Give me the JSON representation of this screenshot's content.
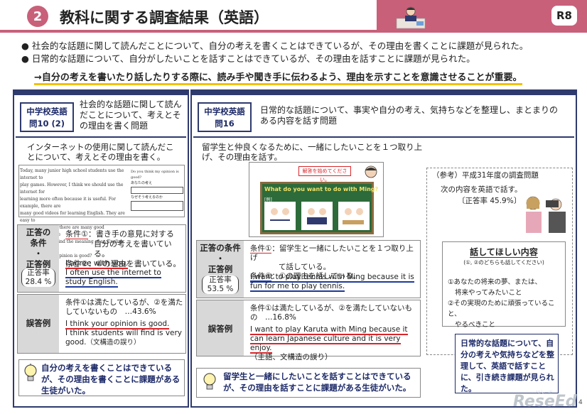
{
  "header": {
    "number": "2",
    "title": "教科に関する調査結果（英語）",
    "badge": "R8"
  },
  "bullets": [
    "●  社会的な話題に関して読んだことについて、自分の考えを書くことはできているが、その理由を書くことに課題が見られた。",
    "●  日常的な話題について、自分がしたいことを話すことはできているが、その理由を話すことに課題が見られた。"
  ],
  "key_point": "→自分の考えを書いたり話したりする際に、読み手や聞き手に伝わるよう、理由を示すことを意識させることが重要。",
  "left": {
    "q_label_1": "中学校英語",
    "q_label_2": "問10 (2)",
    "q_desc": "社会的な話題に関して読んだことについて、考えとその理由を書く問題",
    "prompt": "インターネットの使用に関して読んだことについて、考えとその理由を書く。",
    "quote_lines": [
      "Today, many junior high school students use the internet to",
      "play games. However, I think we should use the internet for",
      "learning more often because it is useful. For example, there are",
      "many good videos for learning English. They are easy to",
      "understand. Also, there are many good dictionaries on the",
      "internet. We can find the meaning of an English word quickly.",
      "Do you think my opinion is good?"
    ],
    "form_q": "Do you think my opinion is good?",
    "form_label_1": "あなたの考え",
    "form_label_2": "なぜそう考えるのか",
    "correct_label_1": "正答の",
    "correct_label_2": "条件",
    "correct_dot": "・",
    "correct_label_3": "正答例",
    "rate_label": "正答率",
    "rate_value": "28.4 %",
    "cond1": "条件①：書き手の意見に対する",
    "cond1b": "自分の考えを書いている。",
    "cond2": "条件②：①の理由を書いている。",
    "example1": "I agree with you.",
    "example2": "I often use the internet to study English.",
    "wrong_label": "誤答例",
    "wrong_desc1": "条件①は満たしているが、②を満た",
    "wrong_desc2": "していないもの　…43.6%",
    "wrong_ex1": "I think your opinion is good.",
    "wrong_ex2": "I think students will find is very good.",
    "wrong_note": "（文構造の誤り）",
    "tip": "自分の考えを書くことはできているが、その理由を書くことに課題がある生徒がいた。"
  },
  "right": {
    "q_label_1": "中学校英語",
    "q_label_2": "問16",
    "q_desc": "日常的な話題について、事実や自分の考え、気持ちなどを整理し、まとまりのある内容を話す問題",
    "prompt": "留学生と仲良くなるために、一緒にしたいことを１つ取り上げ、その理由を話す。",
    "screen_caption": "解答を始めてください。",
    "board_question": "What do you want to do with Ming?",
    "board_example": "[例]",
    "correct_label_1": "正答の条件",
    "correct_dot": "・",
    "correct_label_3": "正答例",
    "rate_label": "正答率",
    "rate_value": "53.5 %",
    "cond1": "条件①：留学生と一緒にしたいことを１つ取り上げ",
    "cond1b": "て話している。",
    "cond2": "条件②：①の理由を話している。",
    "example": "I want to play tennis with Ming because it is fun for me to play tennis.",
    "wrong_label": "誤答例",
    "wrong_desc": "条件①は満たしているが、②を満たしていないもの　…16.8%",
    "wrong_ex": "I want to play Karuta with Ming because it can learn Japanese culture and it is very enjoy.",
    "wrong_note": "（主語、文構造の誤り）",
    "tip": "留学生と一緒にしたいことを話すことはできているが、その理由を話すことに課題がある生徒がいた。",
    "ref_title": "（参考）平成31年度の調査問題",
    "ref_desc": "次の内容を英語で話す。",
    "ref_rate": "〔正答率 45.9%〕",
    "talk_title": "話してほしい内容",
    "talk_sub": "(①, ②のどちらも話してください)",
    "talk_1": "①あなたの将来の夢、または、",
    "talk_1b": "将来やってみたいこと",
    "talk_2": "②その実現のために頑張っていること、",
    "talk_2b": "やるべきこと",
    "closing": "日常的な話題について、自分の考えや気持ちなどを整理して、英語で話すことに、引き続き課題が見られた。"
  },
  "footer": {
    "logo": "ReseEd",
    "logo_small": "リシード",
    "page": "4"
  },
  "colors": {
    "header": "#c8607a",
    "navy": "#2e3a6e",
    "accent": "#f2c200"
  }
}
